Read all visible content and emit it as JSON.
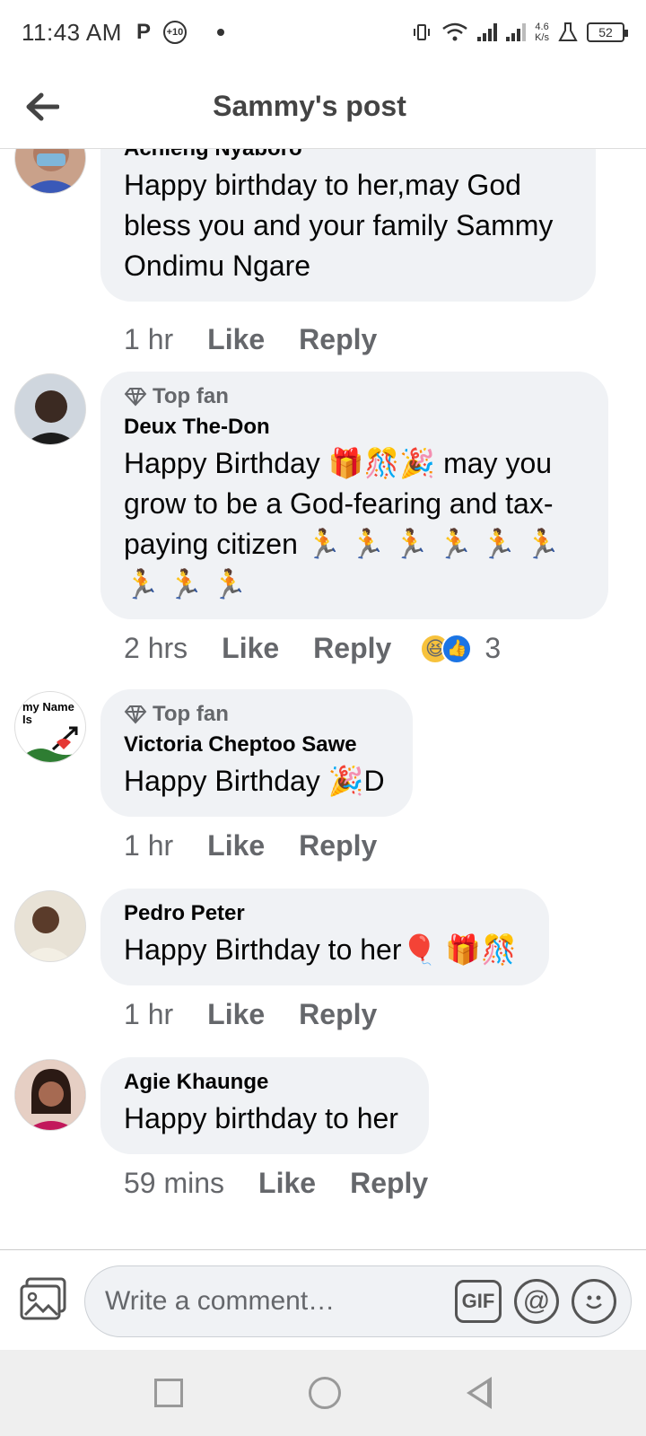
{
  "status_bar": {
    "time": "11:43 AM",
    "p_icon": "P",
    "badge": "+10",
    "speed_value": "4.6",
    "speed_unit": "K/s",
    "battery": "52"
  },
  "header": {
    "title": "Sammy's post",
    "back_icon": "arrow-left-icon"
  },
  "comments": [
    {
      "author": "Achieng Nyaboro",
      "text": "Happy birthday to her,may God bless you and your family  Sammy Ondimu Ngare",
      "time": "1 hr",
      "like": "Like",
      "reply": "Reply"
    },
    {
      "top_fan": "Top fan",
      "author": "Deux The-Don",
      "text": "Happy Birthday 🎁🎊🎉 may you grow to be a God-fearing and tax-paying citizen 🏃 🏃 🏃 🏃 🏃 🏃 🏃 🏃 🏃",
      "time": "2 hrs",
      "like": "Like",
      "reply": "Reply",
      "reaction_count": "3",
      "reactions": [
        "haha",
        "like"
      ]
    },
    {
      "top_fan": "Top fan",
      "author": "Victoria Cheptoo Sawe",
      "text": "Happy Birthday 🎉D",
      "time": "1 hr",
      "like": "Like",
      "reply": "Reply",
      "avatar_text": "my Name Is"
    },
    {
      "author": "Pedro Peter",
      "text": "Happy Birthday to her🎈 🎁🎊",
      "time": "1 hr",
      "like": "Like",
      "reply": "Reply"
    },
    {
      "author": "Agie Khaunge",
      "text": "Happy birthday to her",
      "time": "59 mins",
      "like": "Like",
      "reply": "Reply"
    }
  ],
  "composer": {
    "placeholder": "Write a comment…",
    "gif_label": "GIF",
    "at_label": "@"
  },
  "colors": {
    "bubble": "#f0f2f5",
    "meta_text": "#65676b",
    "like_blue": "#1b74e4"
  }
}
